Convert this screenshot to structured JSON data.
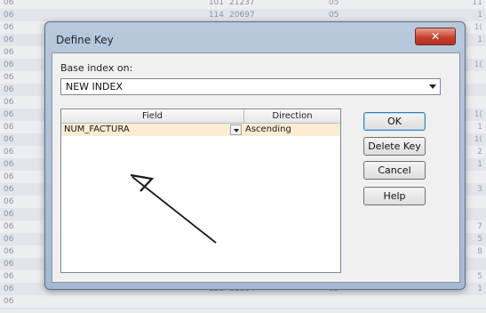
{
  "background_sheet": {
    "rows": [
      {
        "c0": "06",
        "ca": "101",
        "cb": "21237",
        "cc": "05",
        "cr": "11"
      },
      {
        "c0": "06",
        "ca": "114",
        "cb": "20697",
        "cc": "05",
        "cr": "1"
      },
      {
        "c0": "06",
        "ca": "",
        "cb": "",
        "cc": "",
        "cr": "1("
      },
      {
        "c0": "06",
        "ca": "",
        "cb": "",
        "cc": "",
        "cr": "1"
      },
      {
        "c0": "06",
        "ca": "",
        "cb": "",
        "cc": "",
        "cr": ""
      },
      {
        "c0": "06",
        "ca": "",
        "cb": "",
        "cc": "",
        "cr": "1("
      },
      {
        "c0": "06",
        "ca": "",
        "cb": "",
        "cc": "",
        "cr": ""
      },
      {
        "c0": "06",
        "ca": "",
        "cb": "",
        "cc": "",
        "cr": ""
      },
      {
        "c0": "06",
        "ca": "",
        "cb": "",
        "cc": "",
        "cr": ""
      },
      {
        "c0": "06",
        "ca": "",
        "cb": "",
        "cc": "",
        "cr": "1("
      },
      {
        "c0": "06",
        "ca": "",
        "cb": "",
        "cc": "",
        "cr": "1"
      },
      {
        "c0": "06",
        "ca": "",
        "cb": "",
        "cc": "",
        "cr": "1("
      },
      {
        "c0": "06",
        "ca": "",
        "cb": "",
        "cc": "",
        "cr": "2"
      },
      {
        "c0": "06",
        "ca": "",
        "cb": "",
        "cc": "",
        "cr": "1"
      },
      {
        "c0": "06",
        "ca": "",
        "cb": "",
        "cc": "",
        "cr": ""
      },
      {
        "c0": "06",
        "ca": "",
        "cb": "",
        "cc": "",
        "cr": "3"
      },
      {
        "c0": "06",
        "ca": "",
        "cb": "",
        "cc": "",
        "cr": ""
      },
      {
        "c0": "06",
        "ca": "",
        "cb": "",
        "cc": "",
        "cr": ""
      },
      {
        "c0": "06",
        "ca": "",
        "cb": "",
        "cc": "",
        "cr": "7"
      },
      {
        "c0": "06",
        "ca": "",
        "cb": "",
        "cc": "",
        "cr": "5"
      },
      {
        "c0": "06",
        "ca": "",
        "cb": "",
        "cc": "",
        "cr": "8"
      },
      {
        "c0": "06",
        "ca": "",
        "cb": "",
        "cc": "",
        "cr": ""
      },
      {
        "c0": "06",
        "ca": "",
        "cb": "",
        "cc": "",
        "cr": "5"
      },
      {
        "c0": "06",
        "ca": "126",
        "cb": "21164",
        "cc": "05",
        "cr": "1"
      },
      {
        "c0": "06",
        "ca": "",
        "cb": "",
        "cc": "",
        "cr": ""
      }
    ]
  },
  "dialog": {
    "title": "Define Key",
    "close_label": "✕",
    "base_index_label": "Base index on:",
    "base_index_value": "NEW INDEX",
    "grid": {
      "columns": [
        "Field",
        "Direction"
      ],
      "rows": [
        {
          "field": "NUM_FACTURA",
          "direction": "Ascending"
        }
      ]
    },
    "buttons": {
      "ok": "OK",
      "delete_key": "Delete Key",
      "cancel": "Cancel",
      "help": "Help"
    }
  },
  "colors": {
    "row_highlight": "#fbecd2",
    "close_button": "#c6412c",
    "title_bar": "#b9c9dd"
  }
}
